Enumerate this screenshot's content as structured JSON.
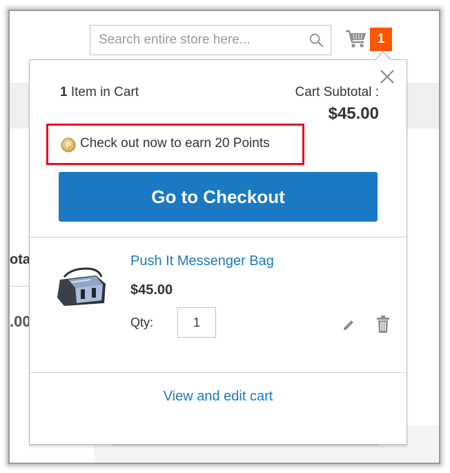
{
  "background": {
    "left_col_text_1": "otal",
    "left_col_text_2": ".00"
  },
  "header": {
    "search_placeholder": "Search entire store here...",
    "search_icon": "search-icon",
    "cart_icon": "cart-icon",
    "cart_count": "1"
  },
  "minicart": {
    "close_icon": "close-icon",
    "items_count_number": "1",
    "items_count_label": "Item in Cart",
    "subtotal_label": "Cart Subtotal :",
    "subtotal_amount": "$45.00",
    "points_icon": "reward-points-coin-icon",
    "points_message": "Check out now to earn 20 Points",
    "checkout_label": "Go to Checkout",
    "items": [
      {
        "name": "Push It Messenger Bag",
        "price": "$45.00",
        "qty_label": "Qty:",
        "qty_value": "1",
        "edit_icon": "pencil-icon",
        "delete_icon": "trash-icon"
      }
    ],
    "view_cart_label": "View and edit cart"
  },
  "colors": {
    "accent": "#1979c3",
    "badge": "#ff5501",
    "highlight_border": "#e3101a"
  }
}
